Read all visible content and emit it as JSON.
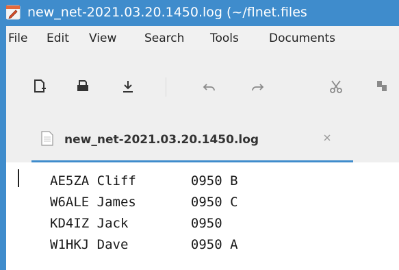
{
  "window": {
    "title": "new_net-2021.03.20.1450.log (~/flnet.files",
    "accent_color": "#3f8ccc"
  },
  "menu": {
    "items": [
      "File",
      "Edit",
      "View",
      "Search",
      "Tools",
      "Documents"
    ]
  },
  "toolbar": {
    "icons": [
      "new-document-icon",
      "open-icon",
      "save-icon",
      "undo-icon",
      "redo-icon",
      "cut-icon",
      "copy-icon"
    ]
  },
  "tab": {
    "label": "new_net-2021.03.20.1450.log",
    "close_glyph": "×"
  },
  "editor": {
    "lines": [
      "AE5ZA Cliff       0950 B",
      "W6ALE James       0950 C",
      "KD4IZ Jack        0950",
      "W1HKJ Dave        0950 A"
    ]
  }
}
